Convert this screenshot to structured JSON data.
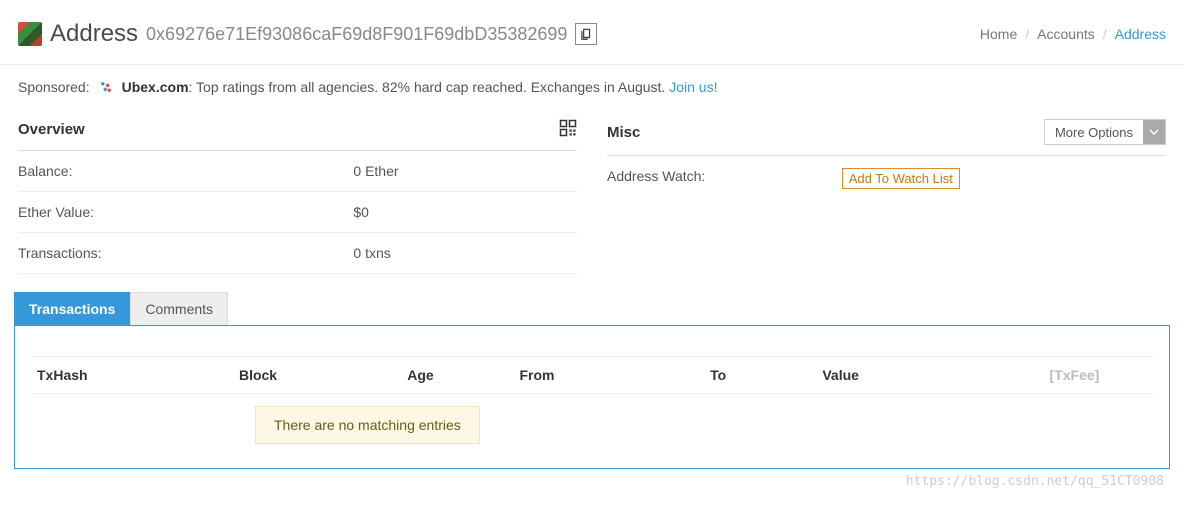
{
  "header": {
    "title": "Address",
    "hash": "0x69276e71Ef93086caF69d8F901F69dbD35382699"
  },
  "breadcrumb": {
    "home": "Home",
    "accounts": "Accounts",
    "current": "Address"
  },
  "sponsor": {
    "label": "Sponsored:",
    "name": "Ubex.com",
    "text": ": Top ratings from all agencies. 82% hard cap reached. Exchanges in August. ",
    "link": "Join us!"
  },
  "overview": {
    "title": "Overview",
    "rows": {
      "balance_label": "Balance:",
      "balance_value": "0 Ether",
      "ether_value_label": "Ether Value:",
      "ether_value_value": "$0",
      "tx_label": "Transactions:",
      "tx_value": "0 txns"
    }
  },
  "misc": {
    "title": "Misc",
    "more_options": "More Options",
    "address_watch_label": "Address Watch:",
    "watch_btn": "Add To Watch List"
  },
  "tabs": {
    "transactions": "Transactions",
    "comments": "Comments"
  },
  "tx_table": {
    "headers": {
      "txhash": "TxHash",
      "block": "Block",
      "age": "Age",
      "from": "From",
      "to": "To",
      "value": "Value",
      "txfee": "[TxFee]"
    },
    "empty_msg": "There are no matching entries"
  },
  "watermark": "https://blog.csdn.net/qq_51CT0908"
}
